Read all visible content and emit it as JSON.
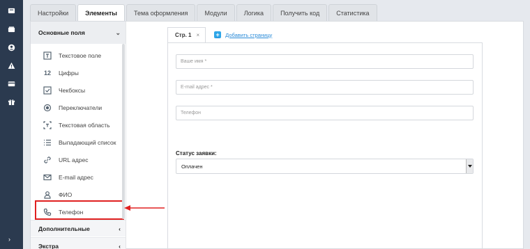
{
  "rail": {
    "icons": [
      "inbox-icon",
      "wallet-icon",
      "user-circle-icon",
      "warning-icon",
      "card-icon",
      "gift-icon"
    ],
    "expand_glyph": "›"
  },
  "tabs": [
    {
      "label": "Настройки",
      "active": false
    },
    {
      "label": "Элементы",
      "active": true
    },
    {
      "label": "Тема оформления",
      "active": false
    },
    {
      "label": "Модули",
      "active": false
    },
    {
      "label": "Логика",
      "active": false
    },
    {
      "label": "Получить код",
      "active": false
    },
    {
      "label": "Статистика",
      "active": false
    }
  ],
  "sidebar": {
    "section_main": "Основные поля",
    "items": [
      {
        "label": "Текстовое поле",
        "icon": "text-field-icon"
      },
      {
        "label": "Цифры",
        "icon": "numbers-icon",
        "glyph": "12"
      },
      {
        "label": "Чекбоксы",
        "icon": "checkbox-icon"
      },
      {
        "label": "Переключатели",
        "icon": "radio-icon"
      },
      {
        "label": "Текстовая область",
        "icon": "textarea-icon"
      },
      {
        "label": "Выпадающий список",
        "icon": "list-icon"
      },
      {
        "label": "URL адрес",
        "icon": "link-icon"
      },
      {
        "label": "E-mail адрес",
        "icon": "mail-icon"
      },
      {
        "label": "ФИО",
        "icon": "person-icon"
      },
      {
        "label": "Телефон",
        "icon": "phone-icon"
      }
    ],
    "section_extra": "Дополнительные",
    "section_extra2": "Экстра"
  },
  "canvas": {
    "page_tab": "Стр. 1",
    "page_tab_close": "×",
    "add_page": "Добавить страницу",
    "fields": [
      {
        "placeholder": "Ваше имя *"
      },
      {
        "placeholder": "E-mail адрес *"
      },
      {
        "placeholder": "Телефон"
      }
    ],
    "status_label": "Статус заявки:",
    "status_value": "Оплачен"
  },
  "colors": {
    "rail": "#2b3a4f",
    "highlight": "#e02020",
    "link": "#2a8bd8"
  }
}
